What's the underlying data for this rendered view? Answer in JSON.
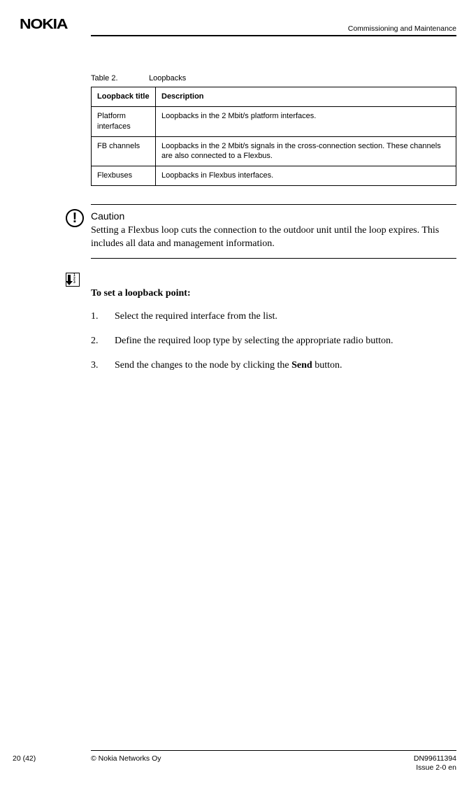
{
  "header": {
    "logo": "NOKIA",
    "section_title": "Commissioning and Maintenance"
  },
  "table": {
    "caption_label": "Table 2.",
    "caption_title": "Loopbacks",
    "headers": {
      "col1": "Loopback title",
      "col2": "Description"
    },
    "rows": [
      {
        "title": "Platform interfaces",
        "desc": "Loopbacks in the 2 Mbit/s platform interfaces."
      },
      {
        "title": "FB channels",
        "desc": "Loopbacks in the 2 Mbit/s signals in the cross-connection section. These channels are also connected to a Flexbus."
      },
      {
        "title": "Flexbuses",
        "desc": "Loopbacks in Flexbus interfaces."
      }
    ]
  },
  "caution": {
    "title": "Caution",
    "body": "Setting a Flexbus loop cuts the connection to the outdoor unit until the loop expires. This includes all data and management information."
  },
  "procedure": {
    "title": "To set a loopback point:",
    "steps": [
      "Select the required interface from the list.",
      "Define the required loop type by selecting the appropriate radio button.",
      "Send the changes to the node by clicking the {SEND} button."
    ],
    "send_label": "Send"
  },
  "footer": {
    "page": "20 (42)",
    "copyright": "© Nokia Networks Oy",
    "docnum": "DN99611394",
    "issue": "Issue 2-0 en"
  }
}
